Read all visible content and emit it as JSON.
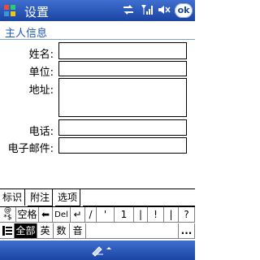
{
  "titlebar": {
    "title": "设置",
    "ok_label": "ok"
  },
  "section": {
    "title": "主人信息"
  },
  "form": {
    "name_label": "姓名:",
    "company_label": "单位:",
    "address_label": "地址:",
    "phone_label": "电话:",
    "email_label": "电子邮件:"
  },
  "tabs": [
    "标识",
    "附注",
    "选项"
  ],
  "sip": {
    "row1": [
      "@ *$",
      "空格",
      "⬅",
      "Del",
      "↵",
      "/",
      "'",
      "1",
      "|",
      "!",
      "|",
      "?"
    ],
    "row2": [
      "全部",
      "英",
      "数",
      "音",
      "...",
      "⋯"
    ]
  },
  "colors": {
    "titlebar": "#1b44a3",
    "section": "#1e5bb6"
  }
}
